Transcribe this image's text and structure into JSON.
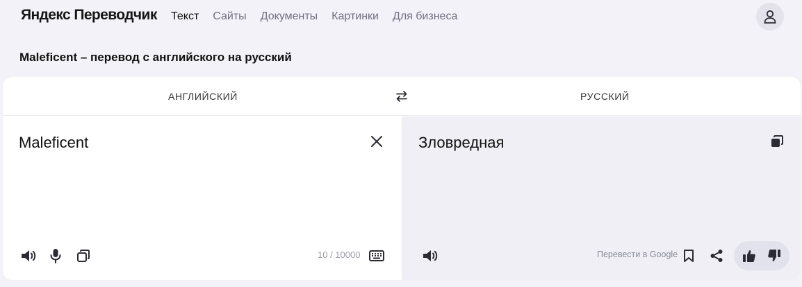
{
  "header": {
    "logo": "Яндекс Переводчик",
    "nav": [
      {
        "label": "Текст",
        "active": true
      },
      {
        "label": "Сайты",
        "active": false
      },
      {
        "label": "Документы",
        "active": false
      },
      {
        "label": "Картинки",
        "active": false
      },
      {
        "label": "Для бизнеса",
        "active": false
      }
    ],
    "avatar_icon": "user-icon"
  },
  "page_title": "Maleficent – перевод с английского на русский",
  "translator": {
    "source_lang": "Английский",
    "target_lang": "Русский",
    "source_text": "Maleficent",
    "target_text": "Зловредная",
    "counter": "10 / 10000",
    "google_link": "Перевести в Google"
  },
  "colors": {
    "page_bg": "#f3f2f8",
    "panel_bg": "#ffffff",
    "result_bg": "#efeff5",
    "icon_color": "#2b2b33"
  }
}
